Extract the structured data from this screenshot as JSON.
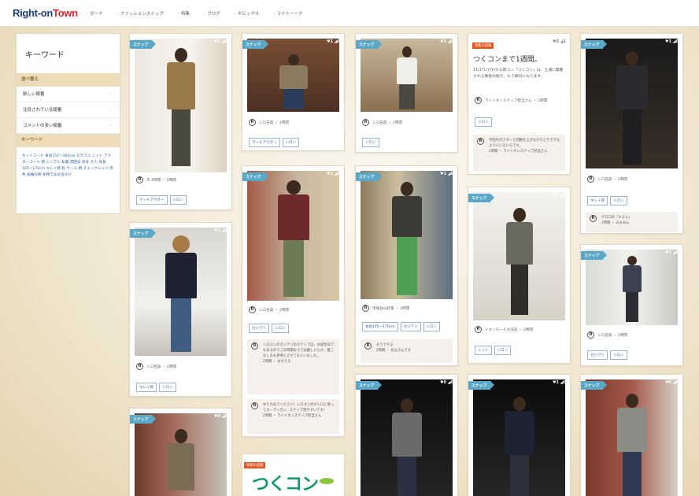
{
  "header": {
    "logo_main": "Right-on",
    "logo_sub": "Town",
    "nav": [
      {
        "label": "ボード"
      },
      {
        "label": "ファッションスナップ"
      },
      {
        "label": "特集"
      },
      {
        "label": "ブログ"
      },
      {
        "label": "ギビックス"
      },
      {
        "label": "ライトーーク"
      }
    ]
  },
  "sidebar": {
    "title": "キーワード",
    "sort_header": "並べ替え",
    "sort_items": [
      {
        "label": "新しい順番"
      },
      {
        "label": "注目されている順番"
      },
      {
        "label": "コメントの多い順番"
      }
    ],
    "keyword_header": "キーワード",
    "keywords": "セットコード 身長155〜160cm カラフル ニット アウターコード 柄 シンプル 私服 雰囲気 秋冬 大人 身長165〜170cm キレイ目 秋 ウール 柄 チェックシャツ 赤色 長袖の柄 冬物ではお出かけ"
  },
  "cards": [
    {
      "tag": "スナップ",
      "counts": "♥1 ◢0",
      "meta": "市 4時間 ・ 2時間",
      "buttons": [
        "マールアウター",
        "シロン"
      ]
    },
    {
      "tag": "スナップ",
      "counts": "♥1 ◢0",
      "meta": "シロ名森 ・ 2時間",
      "buttons": [
        "マールアウター",
        "シロン"
      ]
    },
    {
      "tag": "スナップ",
      "counts": "♥1 ◢0",
      "meta": "シロ名森 ・ 2時間",
      "buttons": [
        "シロン"
      ]
    },
    {
      "tag": "スナップ",
      "counts": "♥1 ◢1",
      "meta": "シロ名森 ・ 2時間",
      "buttons": [
        "キレイ目",
        "シロン"
      ]
    },
    {
      "tag": "スナップ",
      "counts": "♥1 ◢0",
      "meta": "シロ名森 ・ 2時間",
      "buttons": [
        "キレイ目",
        "シロン"
      ]
    },
    {
      "tag": "スナップ",
      "counts": "♥1 ◢0",
      "meta": "シロ名森 ・ 2時間",
      "buttons": [
        "カジアリ",
        "シロン"
      ],
      "comments": [
        {
          "text": "シロゴンのカジアリのスナップは、お誕生日でもあるのでこの時期ならでは嬉しいとか、着こなし方も参考にさせてもらいました。",
          "by": "2時間 ・ おかえる"
        },
        {
          "text": "ゆりかなでください！シロゴンのがシロと寄ってカーディガン、スナップ見やすいです!",
          "by": "2時間 ・ ライトオンスナップ担当さん"
        }
      ]
    },
    {
      "tag": "スナップ",
      "counts": "♥1 ◢0",
      "meta": "市場谷山結束 ・ 2時間",
      "buttons": [
        "身長165〜170cm",
        "カジアリ",
        "シロン"
      ],
      "comments": [
        {
          "text": "そうですよ",
          "by": "2時間 ・ お父さんです"
        }
      ]
    },
    {
      "tag": "スナップ",
      "counts": "♥1 ◢0",
      "meta": "イオンモール大洗店 ・ 2時間",
      "buttons": [
        "ニット",
        "シロン"
      ]
    },
    {
      "tag": "スナップ",
      "counts": "♥1 ◢0",
      "meta": "シロ名森 ・ 2時間",
      "buttons": [
        "カジアリ",
        "シロン"
      ]
    },
    {
      "tag": "スナップ",
      "counts": "♥0 ◢0",
      "meta": "",
      "buttons": []
    },
    {
      "tag": "スナップ",
      "counts": "♥0 ◢0",
      "meta": "",
      "buttons": []
    },
    {
      "tag": "スナップ",
      "counts": "♥1 ◢0",
      "meta": "",
      "buttons": []
    },
    {
      "tag": "スナップ",
      "counts": "♥0 ◢0",
      "meta": "",
      "buttons": []
    },
    {
      "tag": "スナップ",
      "counts": "♥0 ◢0",
      "meta": "",
      "buttons": []
    }
  ],
  "info_card": {
    "category": "特集の話題",
    "counts": "♥0 ◢1",
    "title": "つくコンまで1週間。",
    "desc": "11/17に行われる街コン「つくコン」は、土浦に開催される男性の紹介。もう締切になります。",
    "meta": "ライトオンスナップ担当さん ・ 2時間",
    "button": "シロン",
    "comment": "今回のポスターと回数を上げながらとりできるようにいろいろです。",
    "comment_by": "2時間 ・ ライトオンスナップ担当さん"
  },
  "banner": {
    "category": "特集の話題",
    "logo": "つくコン"
  },
  "colors": {
    "brand_blue": "#1d3e7c",
    "brand_red": "#d8262b",
    "snap_tag": "#5aa8c8",
    "feature_tag": "#e8541d",
    "link_blue": "#2f5ea8"
  }
}
